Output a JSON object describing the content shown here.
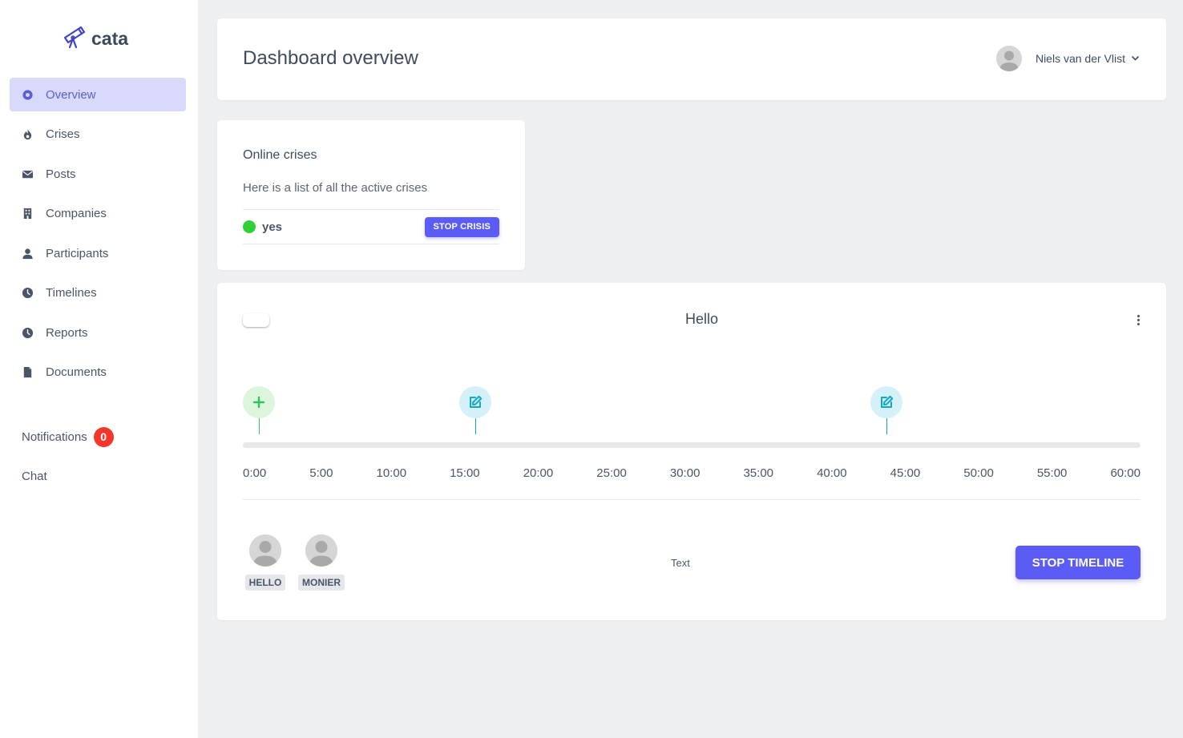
{
  "app": {
    "name": "cata",
    "logo_icon": "telescope-icon",
    "brand_color": "#5b5cf5"
  },
  "sidebar": {
    "items": [
      {
        "label": "Overview",
        "icon": "dot-circle-icon",
        "active": true
      },
      {
        "label": "Crises",
        "icon": "fire-icon",
        "active": false
      },
      {
        "label": "Posts",
        "icon": "envelope-icon",
        "active": false
      },
      {
        "label": "Companies",
        "icon": "building-icon",
        "active": false
      },
      {
        "label": "Participants",
        "icon": "user-icon",
        "active": false
      },
      {
        "label": "Timelines",
        "icon": "clock-icon",
        "active": false
      },
      {
        "label": "Reports",
        "icon": "clock-icon",
        "active": false
      },
      {
        "label": "Documents",
        "icon": "file-icon",
        "active": false
      }
    ],
    "notifications": {
      "label": "Notifications",
      "count": "0",
      "badge_color": "#f5362c"
    },
    "chat": {
      "label": "Chat"
    }
  },
  "header": {
    "title": "Dashboard overview",
    "user": {
      "name": "Niels van der Vlist",
      "icon": "chevron-down-icon"
    }
  },
  "crises": {
    "title": "Online crises",
    "subtitle": "Here is a list of all the active crises",
    "items": [
      {
        "name": "yes",
        "status_color": "#2fd134",
        "action_label": "STOP CRISIS"
      }
    ]
  },
  "timeline": {
    "title": "Hello",
    "duration_minutes": 60,
    "ticks": [
      "0:00",
      "5:00",
      "10:00",
      "15:00",
      "20:00",
      "25:00",
      "30:00",
      "35:00",
      "40:00",
      "45:00",
      "50:00",
      "55:00",
      "60:00"
    ],
    "events": [
      {
        "type": "add",
        "icon": "plus-icon",
        "minute": 0,
        "color": "#33c25a"
      },
      {
        "type": "edit",
        "icon": "edit-icon",
        "minute": 15,
        "color": "#11a8c6"
      },
      {
        "type": "edit",
        "icon": "edit-icon",
        "minute": 43.5,
        "color": "#11a8c6"
      }
    ],
    "participants": [
      "HELLO",
      "MONIER"
    ],
    "text": "Text",
    "stop_label": "STOP TIMELINE"
  }
}
